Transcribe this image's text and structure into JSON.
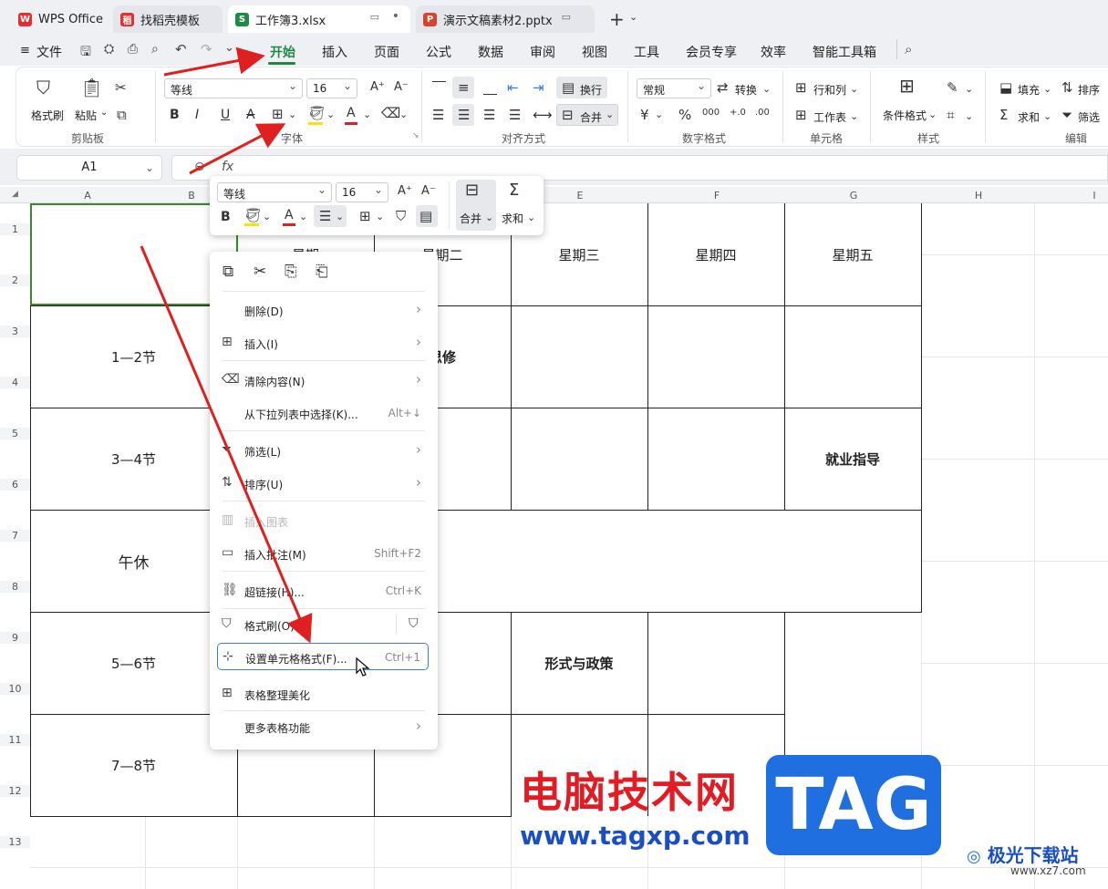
{
  "tabs": [
    {
      "label": "WPS Office",
      "logo": "W",
      "color": "#e23030"
    },
    {
      "label": "找稻壳模板",
      "logo": "稻",
      "color": "#e23030"
    },
    {
      "label": "工作簿3.xlsx",
      "logo": "S",
      "color": "#1e8a45"
    },
    {
      "label": "演示文稿素材2.pptx",
      "logo": "P",
      "color": "#d6452b"
    }
  ],
  "tabbar": {
    "new_tab": "+"
  },
  "menubar": {
    "file": "文件",
    "items": [
      "开始",
      "插入",
      "页面",
      "公式",
      "数据",
      "审阅",
      "视图",
      "工具",
      "会员专享",
      "效率",
      "智能工具箱"
    ],
    "active": "开始"
  },
  "ribbon": {
    "clipboard": {
      "label": "剪贴板",
      "format_painter": "格式刷",
      "paste": "粘贴"
    },
    "font": {
      "label": "字体",
      "name": "等线",
      "size": "16"
    },
    "align": {
      "label": "对齐方式",
      "wrap": "换行",
      "merge": "合并"
    },
    "number": {
      "label": "数字格式",
      "format": "常规",
      "convert": "转换"
    },
    "cells": {
      "label": "单元格",
      "rowcol": "行和列",
      "sheet": "工作表"
    },
    "styles": {
      "label": "样式",
      "cond": "条件格式"
    },
    "edit": {
      "label": "编辑",
      "fill": "填充",
      "sort": "排序",
      "sum": "求和",
      "filter": "筛选"
    }
  },
  "formula": {
    "namebox": "A1",
    "fx": "fx"
  },
  "columns": [
    "A",
    "B",
    "E",
    "F",
    "G",
    "H",
    "I"
  ],
  "rows": [
    "1",
    "2",
    "3",
    "4",
    "5",
    "6",
    "7",
    "8",
    "9",
    "10",
    "11",
    "12",
    "13"
  ],
  "cells": {
    "tue": "星期二",
    "wed": "星期三",
    "thu": "星期四",
    "fri": "星期五",
    "p12": "1—2节",
    "p34": "3—4节",
    "noon": "午休",
    "p56": "5—6节",
    "p78": "7—8节",
    "xiu": "思修",
    "job": "就业指导",
    "policy": "形式与政策",
    "mon": "星期"
  },
  "mini_toolbar": {
    "font": "等线",
    "size": "16",
    "merge": "合并",
    "sum": "求和"
  },
  "context_menu": [
    {
      "label": "删除(D)",
      "shortcut": "",
      "arrow": true,
      "icon": ""
    },
    {
      "label": "插入(I)",
      "shortcut": "",
      "arrow": true,
      "icon": "insert-icon"
    },
    {
      "label": "清除内容(N)",
      "shortcut": "",
      "arrow": true,
      "icon": "eraser-icon"
    },
    {
      "label": "从下拉列表中选择(K)...",
      "shortcut": "Alt+↓",
      "arrow": false,
      "icon": ""
    },
    {
      "label": "筛选(L)",
      "shortcut": "",
      "arrow": true,
      "icon": "filter-icon"
    },
    {
      "label": "排序(U)",
      "shortcut": "",
      "arrow": true,
      "icon": "sort-icon"
    },
    {
      "label": "插入图表",
      "shortcut": "",
      "arrow": false,
      "icon": "chart-icon",
      "disabled": true
    },
    {
      "label": "插入批注(M)",
      "shortcut": "Shift+F2",
      "arrow": false,
      "icon": "comment-icon"
    },
    {
      "label": "超链接(H)...",
      "shortcut": "Ctrl+K",
      "arrow": false,
      "icon": "link-icon"
    },
    {
      "label": "格式刷(O)",
      "shortcut": "",
      "arrow": false,
      "icon": "brush-icon"
    },
    {
      "label": "设置单元格格式(F)...",
      "shortcut": "Ctrl+1",
      "arrow": false,
      "icon": "format-cells-icon",
      "highlight": true
    },
    {
      "label": "表格整理美化",
      "shortcut": "",
      "arrow": false,
      "icon": "beautify-icon"
    },
    {
      "label": "更多表格功能",
      "shortcut": "",
      "arrow": true,
      "icon": ""
    }
  ],
  "watermark": {
    "cn": "电脑技术网",
    "url": "www.tagxp.com",
    "tag": "TAG",
    "site": "极光下载站",
    "site_url": "www.xz7.com"
  },
  "colors": {
    "accent": "#1e8a45",
    "arrow": "#e02020",
    "highlight": "#3b7dd8"
  }
}
